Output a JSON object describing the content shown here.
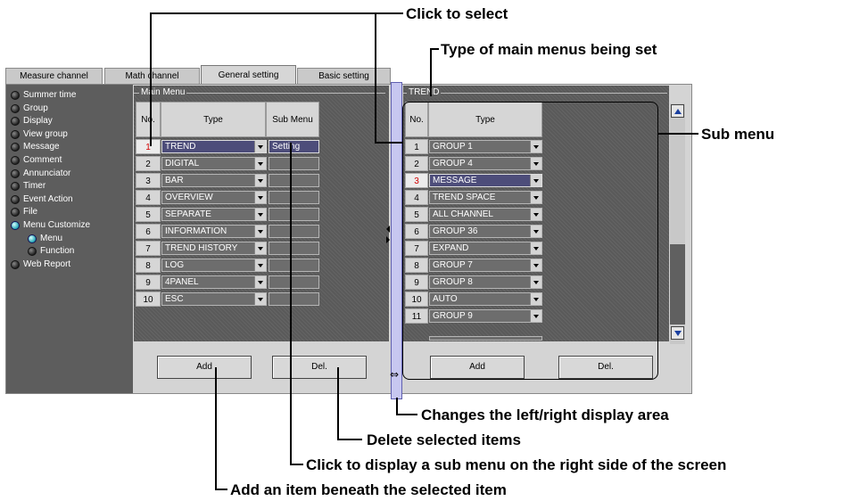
{
  "callouts": {
    "click_to_select": "Click to select",
    "type_of_main_menus": "Type of main menus being set",
    "sub_menu": "Sub menu",
    "changes_display_area": "Changes the left/right display area",
    "delete_selected": "Delete selected items",
    "click_to_display_sub": "Click to display a sub menu on the right side of the screen",
    "add_item_beneath": "Add an item beneath the selected item"
  },
  "tabs": [
    "Measure channel",
    "Math channel",
    "General setting",
    "Basic setting"
  ],
  "active_tab": "General setting",
  "sidebar": {
    "items": [
      {
        "label": "Summer time",
        "selected": false,
        "indent": false
      },
      {
        "label": "Group",
        "selected": false,
        "indent": false
      },
      {
        "label": "Display",
        "selected": false,
        "indent": false
      },
      {
        "label": "View group",
        "selected": false,
        "indent": false
      },
      {
        "label": "Message",
        "selected": false,
        "indent": false
      },
      {
        "label": "Comment",
        "selected": false,
        "indent": false
      },
      {
        "label": "Annunciator",
        "selected": false,
        "indent": false
      },
      {
        "label": "Timer",
        "selected": false,
        "indent": false
      },
      {
        "label": "Event Action",
        "selected": false,
        "indent": false
      },
      {
        "label": "File",
        "selected": false,
        "indent": false
      },
      {
        "label": "Menu Customize",
        "selected": true,
        "indent": false
      },
      {
        "label": "Menu",
        "selected": true,
        "indent": true
      },
      {
        "label": "Function",
        "selected": false,
        "indent": true
      },
      {
        "label": "Web Report",
        "selected": false,
        "indent": false
      }
    ]
  },
  "main_menu": {
    "group_title": "Main Menu",
    "headers": {
      "no": "No.",
      "type": "Type",
      "sub": "Sub Menu"
    },
    "rows": [
      {
        "no": "1",
        "type": "TREND",
        "sub": "Setting",
        "selected": true
      },
      {
        "no": "2",
        "type": "DIGITAL",
        "sub": "",
        "selected": false
      },
      {
        "no": "3",
        "type": "BAR",
        "sub": "",
        "selected": false
      },
      {
        "no": "4",
        "type": "OVERVIEW",
        "sub": "",
        "selected": false
      },
      {
        "no": "5",
        "type": "SEPARATE",
        "sub": "",
        "selected": false
      },
      {
        "no": "6",
        "type": "INFORMATION",
        "sub": "",
        "selected": false
      },
      {
        "no": "7",
        "type": "TREND HISTORY",
        "sub": "",
        "selected": false
      },
      {
        "no": "8",
        "type": "LOG",
        "sub": "",
        "selected": false
      },
      {
        "no": "9",
        "type": "4PANEL",
        "sub": "",
        "selected": false
      },
      {
        "no": "10",
        "type": "ESC",
        "sub": "",
        "selected": false
      }
    ],
    "add_label": "Add",
    "del_label": "Del."
  },
  "trend_menu": {
    "group_title": "TREND",
    "headers": {
      "no": "No.",
      "type": "Type"
    },
    "rows": [
      {
        "no": "1",
        "type": "GROUP 1",
        "selected": false
      },
      {
        "no": "2",
        "type": "GROUP 4",
        "selected": false
      },
      {
        "no": "3",
        "type": "MESSAGE",
        "selected": true
      },
      {
        "no": "4",
        "type": "TREND SPACE",
        "selected": false
      },
      {
        "no": "5",
        "type": "ALL CHANNEL",
        "selected": false
      },
      {
        "no": "6",
        "type": "GROUP 36",
        "selected": false
      },
      {
        "no": "7",
        "type": "EXPAND",
        "selected": false
      },
      {
        "no": "8",
        "type": "GROUP 7",
        "selected": false
      },
      {
        "no": "9",
        "type": "GROUP 8",
        "selected": false
      },
      {
        "no": "10",
        "type": "AUTO",
        "selected": false
      },
      {
        "no": "11",
        "type": "GROUP 9",
        "selected": false
      }
    ],
    "add_label": "Add",
    "del_label": "Del."
  }
}
